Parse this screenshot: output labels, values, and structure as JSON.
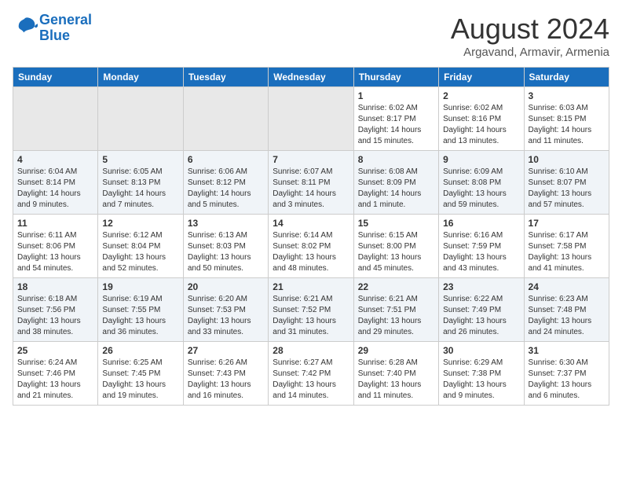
{
  "logo": {
    "line1": "General",
    "line2": "Blue"
  },
  "title": {
    "month_year": "August 2024",
    "location": "Argavand, Armavir, Armenia"
  },
  "days_of_week": [
    "Sunday",
    "Monday",
    "Tuesday",
    "Wednesday",
    "Thursday",
    "Friday",
    "Saturday"
  ],
  "weeks": [
    [
      {
        "day": "",
        "content": ""
      },
      {
        "day": "",
        "content": ""
      },
      {
        "day": "",
        "content": ""
      },
      {
        "day": "",
        "content": ""
      },
      {
        "day": "1",
        "content": "Sunrise: 6:02 AM\nSunset: 8:17 PM\nDaylight: 14 hours\nand 15 minutes."
      },
      {
        "day": "2",
        "content": "Sunrise: 6:02 AM\nSunset: 8:16 PM\nDaylight: 14 hours\nand 13 minutes."
      },
      {
        "day": "3",
        "content": "Sunrise: 6:03 AM\nSunset: 8:15 PM\nDaylight: 14 hours\nand 11 minutes."
      }
    ],
    [
      {
        "day": "4",
        "content": "Sunrise: 6:04 AM\nSunset: 8:14 PM\nDaylight: 14 hours\nand 9 minutes."
      },
      {
        "day": "5",
        "content": "Sunrise: 6:05 AM\nSunset: 8:13 PM\nDaylight: 14 hours\nand 7 minutes."
      },
      {
        "day": "6",
        "content": "Sunrise: 6:06 AM\nSunset: 8:12 PM\nDaylight: 14 hours\nand 5 minutes."
      },
      {
        "day": "7",
        "content": "Sunrise: 6:07 AM\nSunset: 8:11 PM\nDaylight: 14 hours\nand 3 minutes."
      },
      {
        "day": "8",
        "content": "Sunrise: 6:08 AM\nSunset: 8:09 PM\nDaylight: 14 hours\nand 1 minute."
      },
      {
        "day": "9",
        "content": "Sunrise: 6:09 AM\nSunset: 8:08 PM\nDaylight: 13 hours\nand 59 minutes."
      },
      {
        "day": "10",
        "content": "Sunrise: 6:10 AM\nSunset: 8:07 PM\nDaylight: 13 hours\nand 57 minutes."
      }
    ],
    [
      {
        "day": "11",
        "content": "Sunrise: 6:11 AM\nSunset: 8:06 PM\nDaylight: 13 hours\nand 54 minutes."
      },
      {
        "day": "12",
        "content": "Sunrise: 6:12 AM\nSunset: 8:04 PM\nDaylight: 13 hours\nand 52 minutes."
      },
      {
        "day": "13",
        "content": "Sunrise: 6:13 AM\nSunset: 8:03 PM\nDaylight: 13 hours\nand 50 minutes."
      },
      {
        "day": "14",
        "content": "Sunrise: 6:14 AM\nSunset: 8:02 PM\nDaylight: 13 hours\nand 48 minutes."
      },
      {
        "day": "15",
        "content": "Sunrise: 6:15 AM\nSunset: 8:00 PM\nDaylight: 13 hours\nand 45 minutes."
      },
      {
        "day": "16",
        "content": "Sunrise: 6:16 AM\nSunset: 7:59 PM\nDaylight: 13 hours\nand 43 minutes."
      },
      {
        "day": "17",
        "content": "Sunrise: 6:17 AM\nSunset: 7:58 PM\nDaylight: 13 hours\nand 41 minutes."
      }
    ],
    [
      {
        "day": "18",
        "content": "Sunrise: 6:18 AM\nSunset: 7:56 PM\nDaylight: 13 hours\nand 38 minutes."
      },
      {
        "day": "19",
        "content": "Sunrise: 6:19 AM\nSunset: 7:55 PM\nDaylight: 13 hours\nand 36 minutes."
      },
      {
        "day": "20",
        "content": "Sunrise: 6:20 AM\nSunset: 7:53 PM\nDaylight: 13 hours\nand 33 minutes."
      },
      {
        "day": "21",
        "content": "Sunrise: 6:21 AM\nSunset: 7:52 PM\nDaylight: 13 hours\nand 31 minutes."
      },
      {
        "day": "22",
        "content": "Sunrise: 6:21 AM\nSunset: 7:51 PM\nDaylight: 13 hours\nand 29 minutes."
      },
      {
        "day": "23",
        "content": "Sunrise: 6:22 AM\nSunset: 7:49 PM\nDaylight: 13 hours\nand 26 minutes."
      },
      {
        "day": "24",
        "content": "Sunrise: 6:23 AM\nSunset: 7:48 PM\nDaylight: 13 hours\nand 24 minutes."
      }
    ],
    [
      {
        "day": "25",
        "content": "Sunrise: 6:24 AM\nSunset: 7:46 PM\nDaylight: 13 hours\nand 21 minutes."
      },
      {
        "day": "26",
        "content": "Sunrise: 6:25 AM\nSunset: 7:45 PM\nDaylight: 13 hours\nand 19 minutes."
      },
      {
        "day": "27",
        "content": "Sunrise: 6:26 AM\nSunset: 7:43 PM\nDaylight: 13 hours\nand 16 minutes."
      },
      {
        "day": "28",
        "content": "Sunrise: 6:27 AM\nSunset: 7:42 PM\nDaylight: 13 hours\nand 14 minutes."
      },
      {
        "day": "29",
        "content": "Sunrise: 6:28 AM\nSunset: 7:40 PM\nDaylight: 13 hours\nand 11 minutes."
      },
      {
        "day": "30",
        "content": "Sunrise: 6:29 AM\nSunset: 7:38 PM\nDaylight: 13 hours\nand 9 minutes."
      },
      {
        "day": "31",
        "content": "Sunrise: 6:30 AM\nSunset: 7:37 PM\nDaylight: 13 hours\nand 6 minutes."
      }
    ]
  ]
}
